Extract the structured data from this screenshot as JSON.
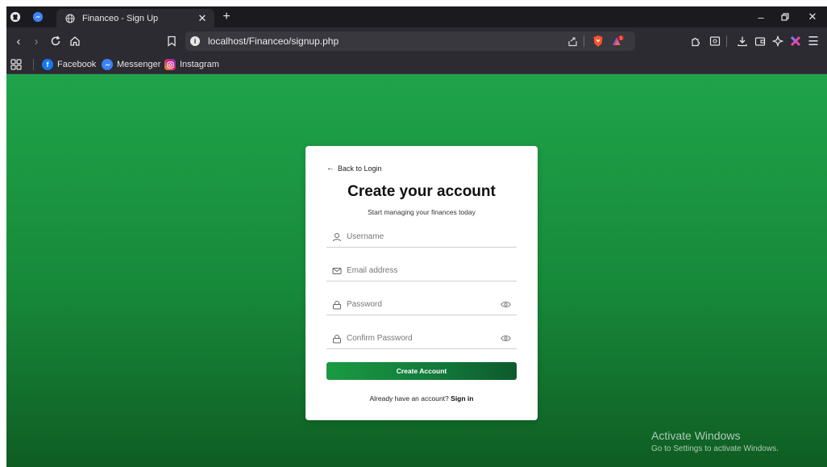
{
  "tab": {
    "title": "Financeo - Sign Up"
  },
  "address_bar": {
    "url": "localhost/Financeo/signup.php",
    "notification_count": "1"
  },
  "bookmarks": [
    {
      "label": "Facebook",
      "icon": "facebook-icon",
      "color": "#1877f2"
    },
    {
      "label": "Messenger",
      "icon": "messenger-icon",
      "color": "#3b82f6"
    },
    {
      "label": "Instagram",
      "icon": "instagram-icon",
      "color": "#d62976"
    }
  ],
  "signup": {
    "back_link": "Back to Login",
    "heading": "Create your account",
    "subheading": "Start managing your finances today",
    "fields": {
      "username": {
        "placeholder": "Username",
        "value": ""
      },
      "email": {
        "placeholder": "Email address",
        "value": ""
      },
      "password": {
        "placeholder": "Password",
        "value": ""
      },
      "confirm_password": {
        "placeholder": "Confirm Password",
        "value": ""
      }
    },
    "submit_label": "Create Account",
    "footer_text": "Already have an account?",
    "footer_link": "Sign in"
  },
  "watermark": {
    "title": "Activate Windows",
    "subtitle": "Go to Settings to activate Windows."
  },
  "colors": {
    "page_gradient_top": "#1fa34a",
    "page_gradient_bottom": "#0f5d23",
    "button": "#12783a",
    "browser_chrome": "#2b2b31"
  }
}
